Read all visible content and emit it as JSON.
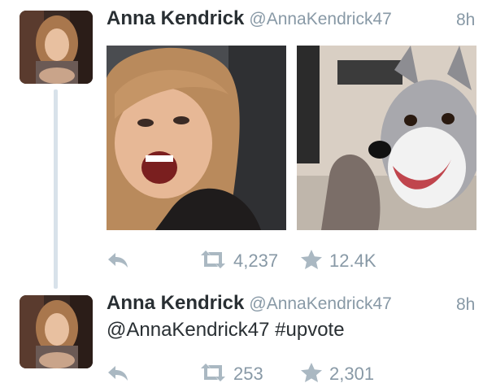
{
  "tweets": [
    {
      "name": "Anna Kendrick",
      "handle": "@AnnaKendrick47",
      "time": "8h",
      "text": "",
      "retweets": "4,237",
      "favorites": "12.4K",
      "media": [
        "woman-laughing-photo",
        "husky-dog-photo"
      ]
    },
    {
      "name": "Anna Kendrick",
      "handle": "@AnnaKendrick47",
      "time": "8h",
      "text": "@AnnaKendrick47 #upvote",
      "retweets": "253",
      "favorites": "2,301"
    }
  ],
  "icons": {
    "reply": "reply-icon",
    "retweet": "retweet-icon",
    "favorite": "star-icon"
  },
  "colors": {
    "name": "#292f33",
    "meta": "#8899a6",
    "icon": "#aab8c2",
    "thread_line": "#d8e2ea"
  }
}
